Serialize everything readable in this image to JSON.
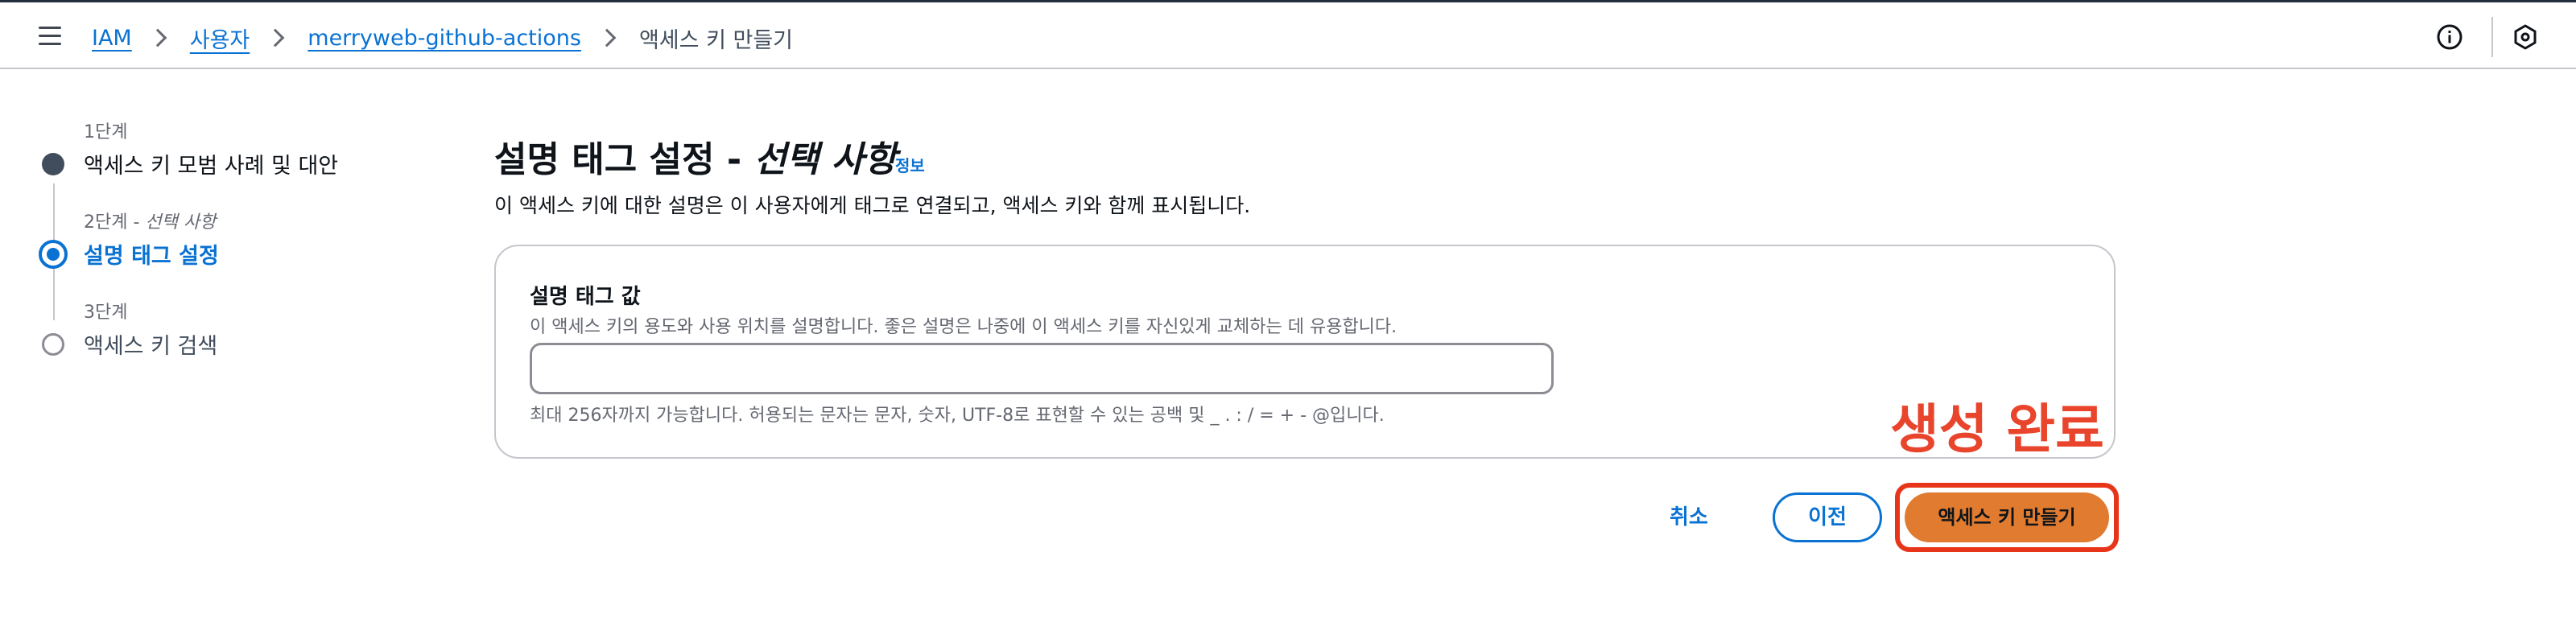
{
  "breadcrumb": {
    "items": [
      "IAM",
      "사용자",
      "merryweb-github-actions"
    ],
    "current": "액세스 키 만들기"
  },
  "steps": [
    {
      "label": "1단계",
      "title": "액세스 키 모범 사례 및 대안",
      "state": "completed"
    },
    {
      "label": "2단계",
      "label_optional": "선택 사항",
      "title": "설명 태그 설정",
      "state": "active"
    },
    {
      "label": "3단계",
      "title": "액세스 키 검색",
      "state": "pending"
    }
  ],
  "main": {
    "title": "설명 태그 설정",
    "title_sep": " - ",
    "title_optional": "선택 사항",
    "info_link": "정보",
    "description": "이 액세스 키에 대한 설명은 이 사용자에게 태그로 연결되고, 액세스 키와 함께 표시됩니다."
  },
  "form": {
    "label": "설명 태그 값",
    "description": "이 액세스 키의 용도와 사용 위치를 설명합니다. 좋은 설명은 나중에 이 액세스 키를 자신있게 교체하는 데 유용합니다.",
    "value": "",
    "placeholder": "",
    "constraint": "최대 256자까지 가능합니다. 허용되는 문자는 문자, 숫자, UTF-8로 표현할 수 있는 공백 및 _ . : / = + - @입니다."
  },
  "annotation": "생성 완료",
  "buttons": {
    "cancel": "취소",
    "previous": "이전",
    "create": "액세스 키 만들기"
  },
  "colors": {
    "link": "#0972d3",
    "primary_button": "#e07b2f",
    "annotation": "#e8452c",
    "step_completed": "#414d5c"
  },
  "icons": {
    "menu": "hamburger-menu-icon",
    "info": "info-circle-icon",
    "notifications": "hexagon-icon"
  }
}
